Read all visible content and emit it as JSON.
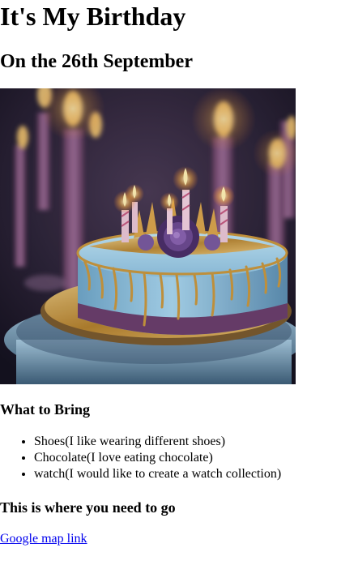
{
  "page": {
    "title": "It's My Birthday",
    "date_heading": "On the 26th September"
  },
  "image": {
    "subject": "birthday-cake"
  },
  "bring": {
    "heading": "What to Bring",
    "items": [
      "Shoes(I like wearing different shoes)",
      "Chocolate(I love eating chocolate)",
      "watch(I would like to create a watch collection)"
    ]
  },
  "directions": {
    "heading": "This is where you need to go",
    "link_text": "Google map link"
  },
  "colors": {
    "link": "#0000ee",
    "text": "#000000",
    "background": "#ffffff"
  }
}
